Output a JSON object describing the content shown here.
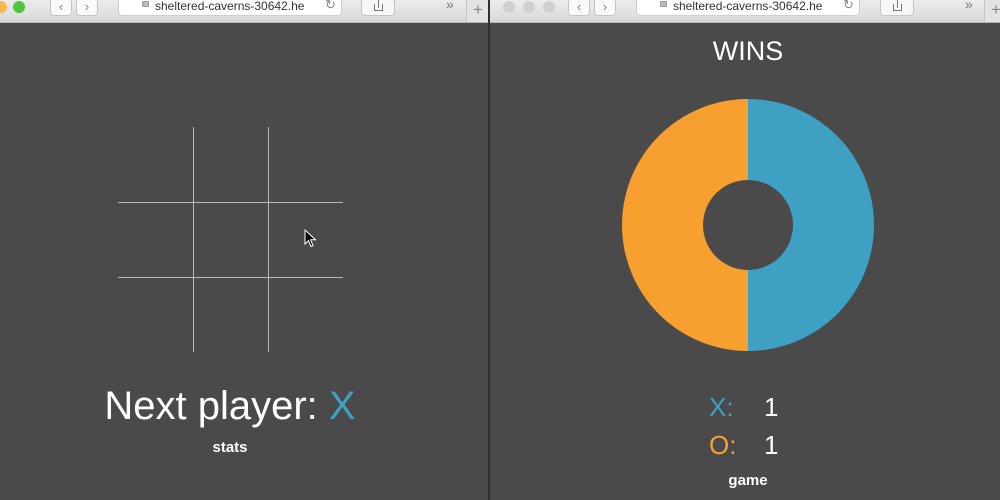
{
  "left_window": {
    "url": "sheltered-caverns-30642.he",
    "board": {
      "cells": [
        "",
        "",
        "",
        "",
        "",
        "",
        "",
        "",
        ""
      ]
    },
    "next_player_label": "Next player:",
    "next_player_value": "X",
    "stats_link": "stats"
  },
  "right_window": {
    "url": "sheltered-caverns-30642.he",
    "wins_title": "WINS",
    "scores": [
      {
        "label": "X:",
        "value": "1",
        "color": "#3ea0c2"
      },
      {
        "label": "O:",
        "value": "1",
        "color": "#f7a030"
      }
    ],
    "game_link": "game"
  },
  "chart_data": {
    "type": "pie",
    "title": "WINS",
    "categories": [
      "X",
      "O"
    ],
    "values": [
      1,
      1
    ],
    "colors": [
      "#3ea0c2",
      "#f7a030"
    ],
    "donut": true
  },
  "icons": {
    "back": "‹",
    "forward": "›",
    "reload": "↻",
    "overflow": "»",
    "new_tab": "+"
  },
  "colors": {
    "background": "#4a4a4a",
    "x_player": "#3ea0c2",
    "o_player": "#f7a030"
  }
}
